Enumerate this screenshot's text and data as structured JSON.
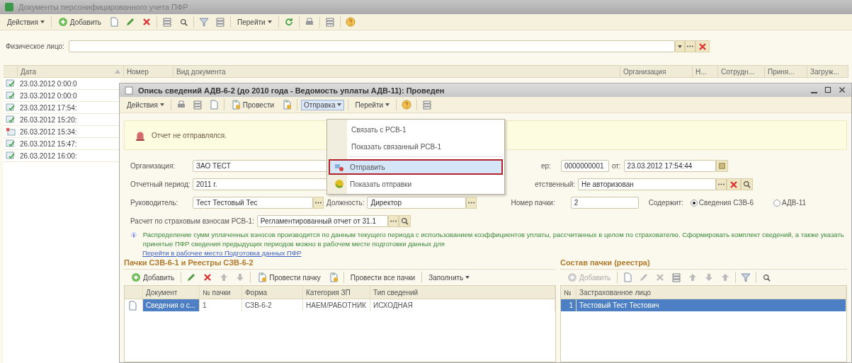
{
  "main_window": {
    "title": "Документы персонифицированного учета ПФР",
    "toolbar": {
      "actions": "Действия",
      "add": "Добавить",
      "goto": "Перейти"
    },
    "filter": {
      "label": "Физическое лицо:"
    },
    "table": {
      "columns": [
        "Дата",
        "Номер",
        "Вид документа",
        "Организация",
        "Н...",
        "Сотрудн...",
        "Приня...",
        "Загруж..."
      ],
      "rows": [
        {
          "date": "23.03.2012 0:00:0",
          "deleted": false
        },
        {
          "date": "23.03.2012 0:00:0",
          "deleted": false
        },
        {
          "date": "23.03.2012 17:54:",
          "deleted": false
        },
        {
          "date": "26.03.2012 15:20:",
          "deleted": false
        },
        {
          "date": "26.03.2012 15:34:",
          "deleted": true
        },
        {
          "date": "26.03.2012 15:47:",
          "deleted": false
        },
        {
          "date": "26.03.2012 16:00:",
          "deleted": false
        }
      ]
    }
  },
  "doc_window": {
    "title": "Опись сведений АДВ-6-2 (до 2010 года - Ведомость уплаты АДВ-11): Проведен",
    "toolbar": {
      "actions": "Действия",
      "post": "Провести",
      "send": "Отправка",
      "send_open": true,
      "goto": "Перейти"
    },
    "send_menu": [
      {
        "kind": "item",
        "label": "Связать с РСВ-1",
        "selected": false
      },
      {
        "kind": "item",
        "label": "Показать связанный РСВ-1",
        "selected": false
      },
      {
        "kind": "separator"
      },
      {
        "kind": "icon_item",
        "label": "Отправить",
        "selected": true
      },
      {
        "kind": "icon_item",
        "label": "Показать отправки",
        "selected": false
      }
    ],
    "banner": "Отчет не отправлялся.",
    "organization": {
      "label": "Организация:",
      "value": "ЗАО ТЕСТ"
    },
    "number": {
      "label": "ер:",
      "value": "0000000001",
      "date_label": "от:",
      "date": "23.03.2012 17:54:44"
    },
    "period": {
      "label": "Отчетный период:",
      "value": "2011 г."
    },
    "responsible": {
      "label": "етственный:",
      "value": "Не авторизован"
    },
    "manager": {
      "label": "Руководитель:",
      "value": "Тест Тестовый Тес"
    },
    "position": {
      "label": "Должность:",
      "value": "Директор"
    },
    "pack_number": {
      "label": "Номер пачки:",
      "value": "2"
    },
    "contains": {
      "label": "Содержит:",
      "options": [
        {
          "label": "Сведения СЗВ-6",
          "selected": true
        },
        {
          "label": "АДВ-11",
          "selected": false
        }
      ]
    },
    "rsv": {
      "label": "Расчет по страховым взносам РСВ-1:",
      "value": "Регламентированный отчет от 31.1"
    },
    "info": "Распределение сумм уплаченных взносов производится по данным текущего периода с использованием коэффициентов уплаты, рассчитанных в целом по страхователю. Сформировать комплект сведений, а также указать принятые ПФР сведения предыдущих периодов можно в рабочем месте подготовки данных для",
    "link": "Перейти в рабочее место Подготовка данных ПФР",
    "packs": {
      "title": "Пачки СЗВ-6-1 и Реестры СЗВ-6-2",
      "toolbar": {
        "add": "Добавить",
        "post_pack": "Провести пачку",
        "post_all": "Провести все пачки",
        "fill": "Заполнить"
      },
      "columns": [
        "Документ",
        "№ пачки",
        "Форма",
        "Категория ЗП",
        "Тип сведений"
      ],
      "rows": [
        {
          "cells": [
            "Сведения о с...",
            "1",
            "СЗВ-6-2",
            "НАЕМ/РАБОТНИК",
            "ИСХОДНАЯ"
          ],
          "selected": true
        }
      ]
    },
    "pack_content": {
      "title": "Состав пачки (реестра)",
      "toolbar": {
        "add": "Добавить"
      },
      "columns": [
        "№",
        "Застрахованное лицо"
      ],
      "rows": [
        {
          "num": "1",
          "name": "Тестовый Тест Тестович",
          "selected": true
        }
      ]
    }
  }
}
